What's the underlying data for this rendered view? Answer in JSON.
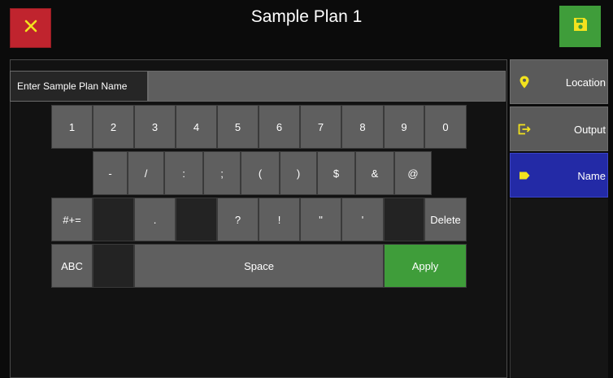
{
  "header": {
    "title": "Sample Plan 1"
  },
  "name_field": {
    "label": "Enter Sample Plan Name",
    "value": ""
  },
  "keyboard": {
    "row1": [
      "1",
      "2",
      "3",
      "4",
      "5",
      "6",
      "7",
      "8",
      "9",
      "0"
    ],
    "row2": [
      "-",
      "/",
      ":",
      ";",
      "(",
      ")",
      "$",
      "&",
      "@"
    ],
    "row3": {
      "mode_key": "#+=",
      "dot": ".",
      "question": "?",
      "exclaim": "!",
      "quote": "\"",
      "apostrophe": "'",
      "delete": "Delete"
    },
    "row4": {
      "abc": "ABC",
      "space": "Space",
      "apply": "Apply"
    }
  },
  "sidebar": {
    "items": [
      {
        "label": "Location",
        "icon": "map-pin-icon",
        "active": false
      },
      {
        "label": "Output",
        "icon": "output-icon",
        "active": false
      },
      {
        "label": "Name",
        "icon": "tag-icon",
        "active": true
      }
    ]
  },
  "colors": {
    "close": "#c0242e",
    "save": "#3f9d3a",
    "apply": "#3f9d3a",
    "active_tab": "#232aa6",
    "icon_yellow": "#f2e21e"
  }
}
